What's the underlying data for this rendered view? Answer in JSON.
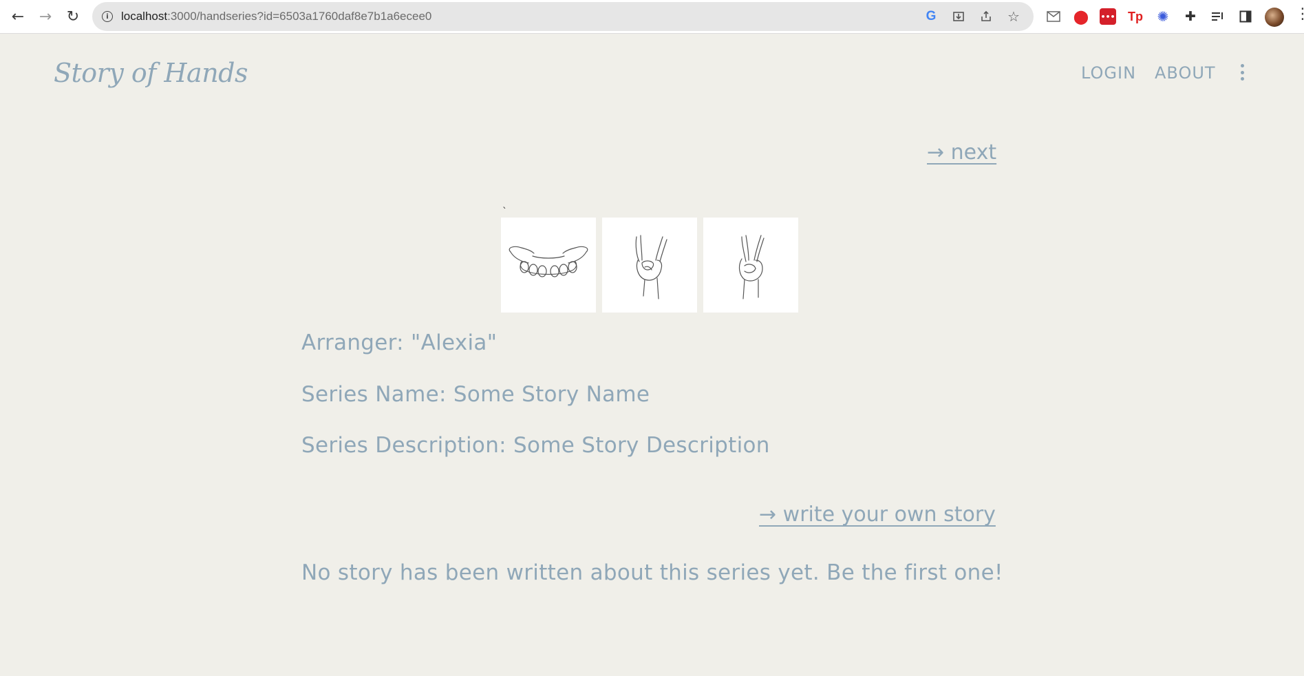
{
  "browser": {
    "url_host": "localhost",
    "url_rest": ":3000/handseries?id=6503a1760daf8e7b1a6ecee0",
    "back_icon": "arrow-left-icon",
    "forward_icon": "arrow-right-icon",
    "reload_icon": "reload-icon"
  },
  "site": {
    "logo": "Story of Hands",
    "nav": {
      "login": "LOGIN",
      "about": "ABOUT"
    }
  },
  "series": {
    "next_link": "→ next",
    "hands": [
      {
        "icon": "open-palms-hands-icon"
      },
      {
        "icon": "rock-horns-hand-icon"
      },
      {
        "icon": "peace-sign-hand-icon"
      }
    ],
    "arranger": "Arranger: \"Alexia\"",
    "name": "Series Name: Some Story Name",
    "description": "Series Description: Some Story Description",
    "write_link": "→ write your own story",
    "empty_message": "No story has been written about this series yet. Be the first one!"
  },
  "colors": {
    "background": "#f0efe9",
    "accent": "#8fa7b8"
  }
}
